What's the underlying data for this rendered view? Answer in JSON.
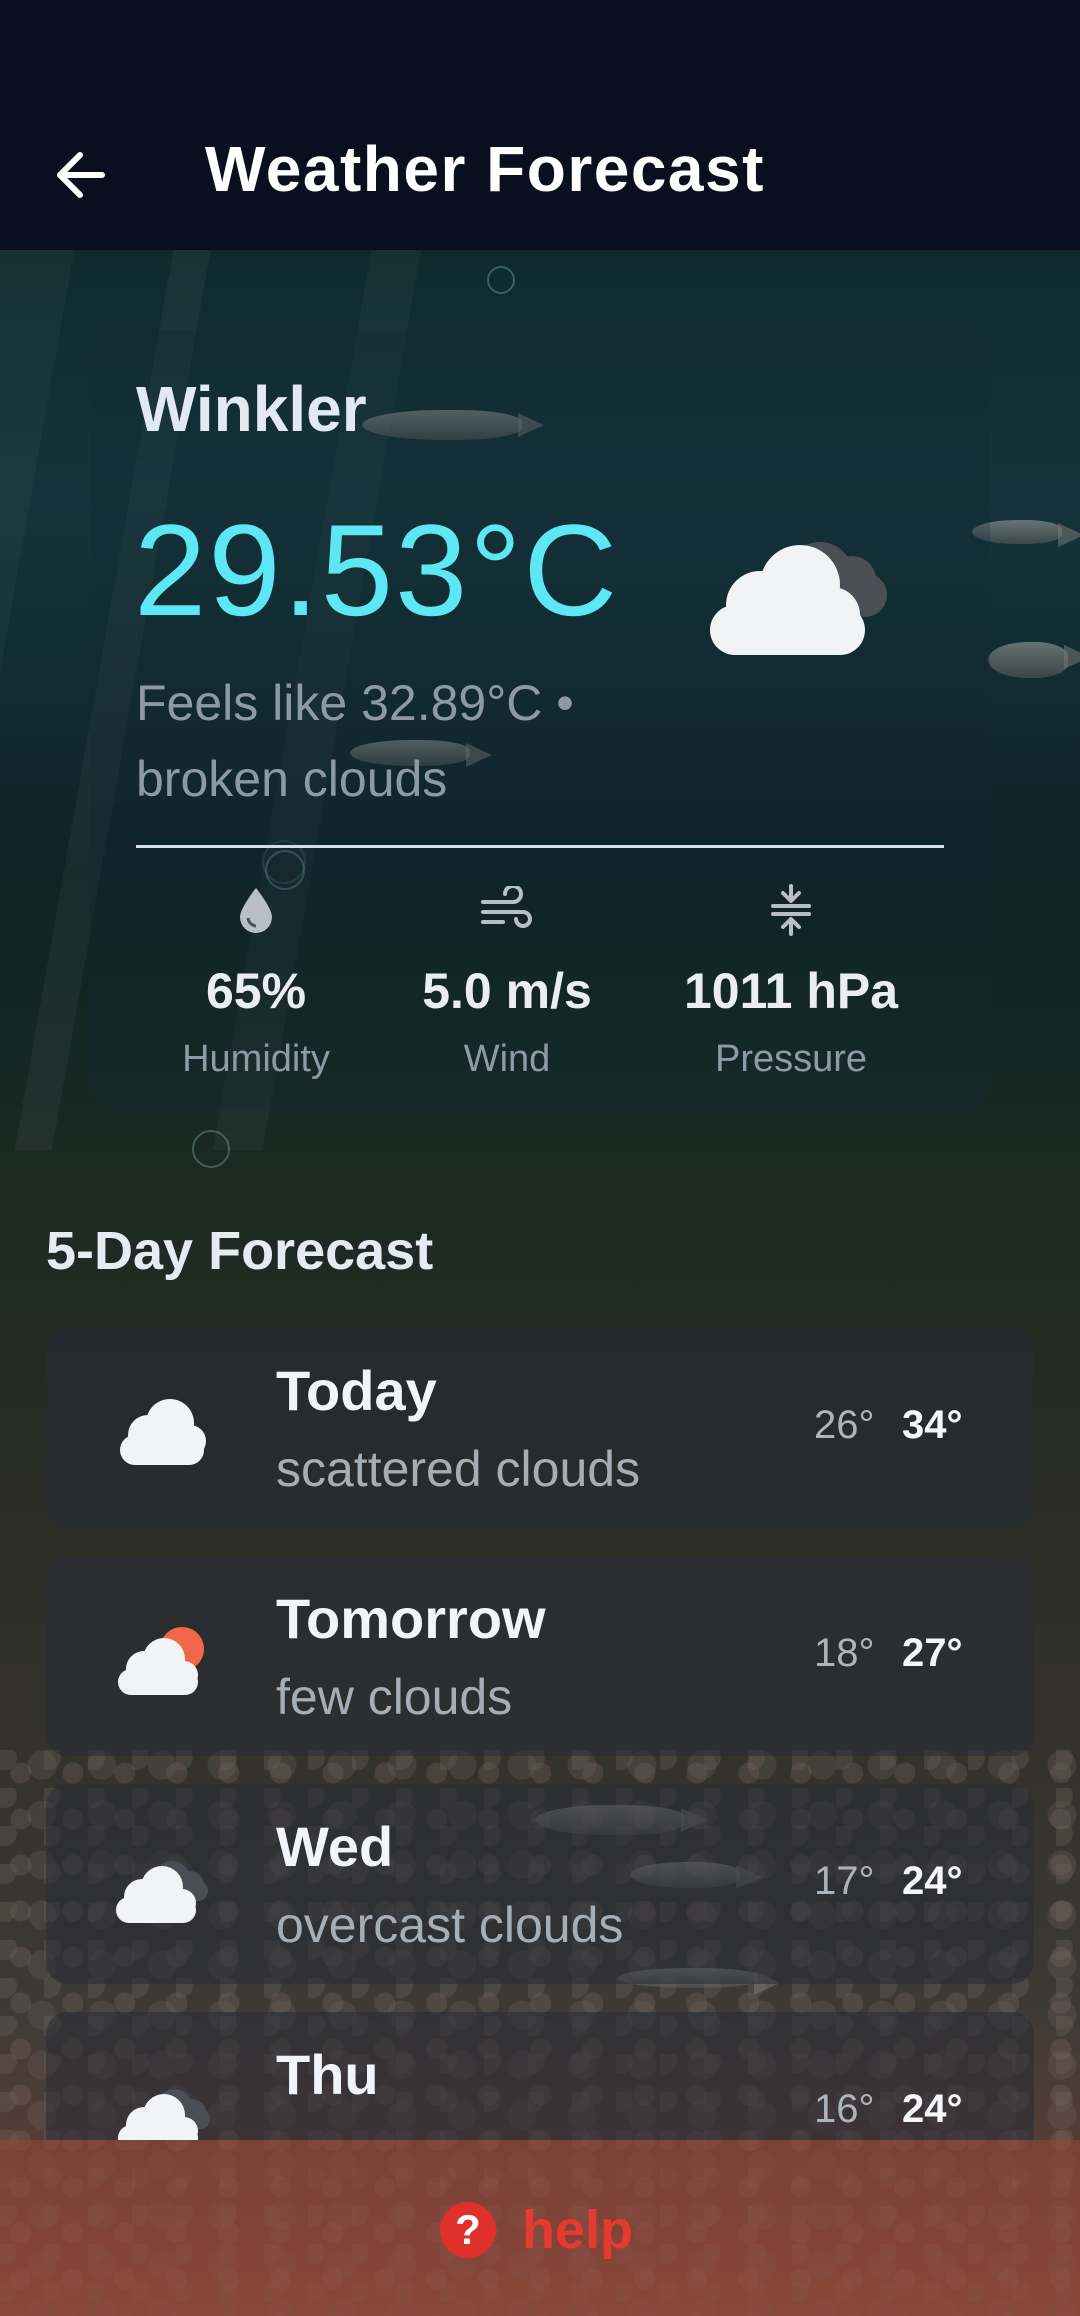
{
  "app_bar": {
    "title": "Weather Forecast",
    "back_icon": "arrow-left-icon"
  },
  "current": {
    "city": "Winkler",
    "temperature": "29.53°C",
    "description": "Feels like 32.89°C • broken clouds",
    "icon": "broken-clouds-icon",
    "stats": [
      {
        "icon": "water-drop-icon",
        "value": "65%",
        "label": "Humidity"
      },
      {
        "icon": "wind-icon",
        "value": "5.0 m/s",
        "label": "Wind"
      },
      {
        "icon": "pressure-icon",
        "value": "1011 hPa",
        "label": "Pressure"
      }
    ]
  },
  "forecast": {
    "title": "5-Day Forecast",
    "days": [
      {
        "name": "Today",
        "desc": "scattered clouds",
        "low": "26°",
        "high": "34°",
        "icon": "scattered-clouds-icon"
      },
      {
        "name": "Tomorrow",
        "desc": "few clouds",
        "low": "18°",
        "high": "27°",
        "icon": "few-clouds-icon"
      },
      {
        "name": "Wed",
        "desc": "overcast clouds",
        "low": "17°",
        "high": "24°",
        "icon": "overcast-clouds-icon"
      },
      {
        "name": "Thu",
        "desc": "",
        "low": "16°",
        "high": "24°",
        "icon": "broken-clouds-icon"
      }
    ]
  },
  "help": {
    "label": "help",
    "icon_glyph": "?"
  },
  "colors": {
    "temperature": "#5ce7f2",
    "help_accent": "#e43a2f",
    "sun": "#f0674a"
  }
}
